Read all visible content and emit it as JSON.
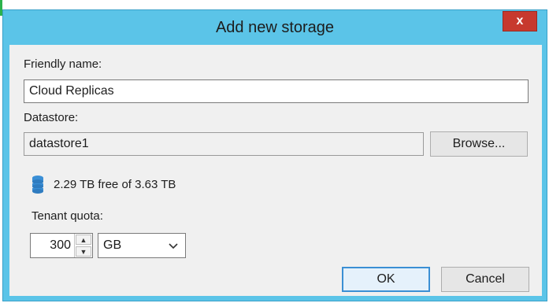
{
  "dialog": {
    "title": "Add new storage",
    "close_glyph": "x"
  },
  "friendly_name": {
    "label": "Friendly name:",
    "value": "Cloud Replicas"
  },
  "datastore": {
    "label": "Datastore:",
    "value": "datastore1",
    "browse_label": "Browse..."
  },
  "capacity": {
    "icon": "database-icon",
    "text": "2.29 TB free of 3.63 TB"
  },
  "quota": {
    "label": "Tenant quota:",
    "value": "300",
    "unit": "GB"
  },
  "actions": {
    "ok_label": "OK",
    "cancel_label": "Cancel"
  },
  "colors": {
    "window_frame": "#5bc4e8",
    "client_bg": "#f0f0f0",
    "close_button": "#c7392e",
    "accent": "#3b8fd4"
  }
}
